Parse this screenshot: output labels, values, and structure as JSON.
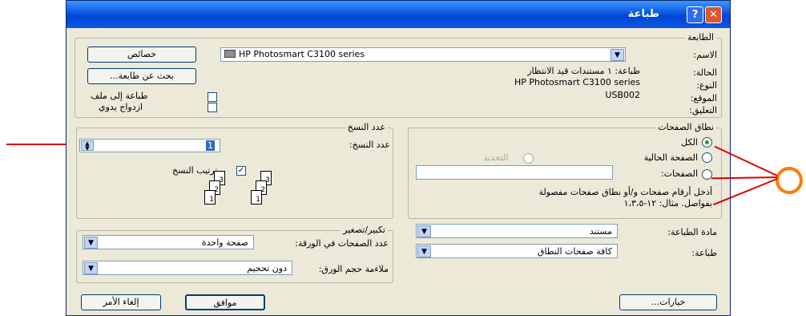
{
  "dialog": {
    "title": "طباعة",
    "help_label": "?",
    "close_label": "✕"
  },
  "printer": {
    "legend": "الطابعة",
    "name_label": "الاسم:",
    "name_value": "HP Photosmart C3100 series",
    "status_label": "الحالة:",
    "status_value": "طباعة: ١ مستندات قيد الانتظار",
    "type_label": "النوع:",
    "type_value": "HP Photosmart C3100 series",
    "where_label": "الموقع:",
    "where_value": "USB002",
    "comment_label": "التعليق:",
    "properties_button": "خصائص",
    "find_printer_button": "بحث عن طابعة...",
    "print_to_file_label": "طباعة إلى ملف",
    "manual_duplex_label": "ازدواج يدوي",
    "print_to_file_checked": false,
    "manual_duplex_checked": false
  },
  "page_range": {
    "legend": "نطاق الصفحات",
    "all_label": "الكل",
    "current_page_label": "الصفحة الحالية",
    "selection_label": "التحديد",
    "pages_label": "الصفحات:",
    "pages_value": "",
    "hint_line1": "أدخل أرقام صفحات و/أو نطاق صفحات مفصولة",
    "hint_line2": "بفواصل. مثال: ١٢-١،٣،٥",
    "selected": "all"
  },
  "copies": {
    "legend": "عدد النسخ",
    "count_label": "عدد النسخ:",
    "count_value": "1",
    "collate_label": "ترتيب النسخ",
    "collate_checked": true,
    "page_numbers": [
      "1",
      "2",
      "3"
    ]
  },
  "print_what": {
    "label": "مادة الطباعة:",
    "value": "مستند"
  },
  "print_filter": {
    "label": "طباعة:",
    "value": "كافة صفحات النطاق"
  },
  "zoom": {
    "legend": "تكبير/تصغير",
    "pages_per_sheet_label": "عدد الصفحات في الورقة:",
    "pages_per_sheet_value": "صفحة واحدة",
    "scale_label": "ملاءمة حجم الورق:",
    "scale_value": "دون تحجيم"
  },
  "buttons": {
    "options": "خيارات...",
    "ok": "موافق",
    "cancel": "إلغاء الأمر"
  },
  "annotation_color": "#e00000",
  "accent_color": "#0a58e0"
}
